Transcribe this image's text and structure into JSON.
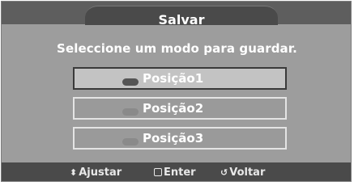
{
  "dialog": {
    "title": "Salvar",
    "prompt": "Seleccione um modo para guardar."
  },
  "slots": [
    {
      "label": "Posição1",
      "selected": true
    },
    {
      "label": "Posição2",
      "selected": false
    },
    {
      "label": "Posição3",
      "selected": false
    }
  ],
  "footer": {
    "adjust": {
      "icon": "up-down-arrow-icon",
      "label": "Ajustar"
    },
    "enter": {
      "icon": "enter-icon",
      "label": "Enter"
    },
    "back": {
      "icon": "return-icon",
      "label": "Voltar"
    }
  },
  "colors": {
    "background": "#9d9d9d",
    "title_bar": "#5e5e5e",
    "footer": "#4a4a4a",
    "selected_slot": "#c3c3c3"
  }
}
